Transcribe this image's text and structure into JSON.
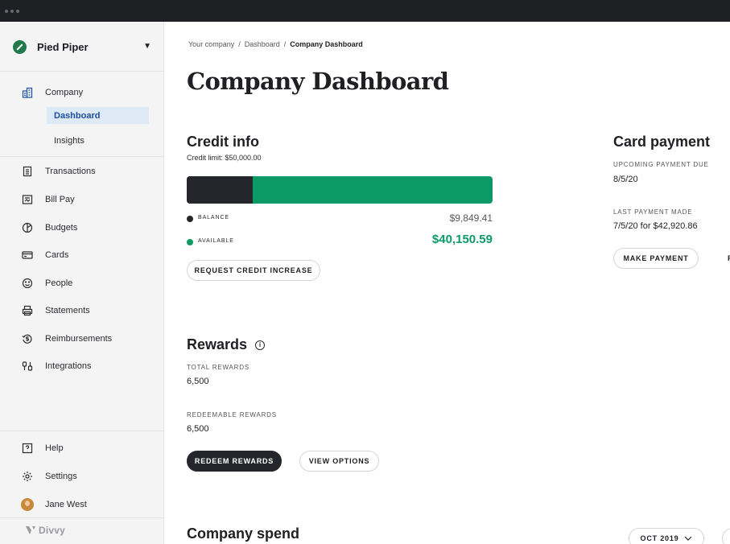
{
  "org": {
    "name": "Pied Piper"
  },
  "sidebar": {
    "company_label": "Company",
    "sub_items": [
      {
        "label": "Dashboard",
        "active": true
      },
      {
        "label": "Insights",
        "active": false
      }
    ],
    "items": [
      {
        "label": "Transactions",
        "icon": "receipt-icon"
      },
      {
        "label": "Bill Pay",
        "icon": "bill-icon"
      },
      {
        "label": "Budgets",
        "icon": "budget-icon"
      },
      {
        "label": "Cards",
        "icon": "card-icon"
      },
      {
        "label": "People",
        "icon": "smile-icon"
      },
      {
        "label": "Statements",
        "icon": "printer-icon"
      },
      {
        "label": "Reimbursements",
        "icon": "refund-icon"
      },
      {
        "label": "Integrations",
        "icon": "plug-icon"
      }
    ],
    "footer": {
      "help": "Help",
      "settings": "Settings",
      "user": "Jane West"
    },
    "brand": "Divvy"
  },
  "breadcrumb": {
    "items": [
      "Your company",
      "Dashboard",
      "Company Dashboard"
    ],
    "separator": "/"
  },
  "page_title": "Company Dashboard",
  "credit_info": {
    "title": "Credit info",
    "limit_text": "Credit limit: $50,000.00",
    "used_fraction": 0.2148,
    "balance_label": "BALANCE",
    "balance_value": "$9,849.41",
    "available_label": "AVAILABLE",
    "available_value": "$40,150.59",
    "request_button": "REQUEST CREDIT INCREASE",
    "colors": {
      "balance": "#25262b",
      "available": "#0b9a66"
    }
  },
  "card_payment": {
    "title": "Card payment",
    "upcoming_label": "UPCOMING PAYMENT DUE",
    "upcoming_value": "8/5/20",
    "last_label": "LAST PAYMENT MADE",
    "last_value": "7/5/20 for $42,920.86",
    "make_payment_button": "MAKE PAYMENT",
    "next_button_partial": "P"
  },
  "rewards": {
    "title": "Rewards",
    "total_label": "TOTAL REWARDS",
    "total_value": "6,500",
    "redeemable_label": "REDEEMABLE REWARDS",
    "redeemable_value": "6,500",
    "redeem_button": "REDEEM REWARDS",
    "view_options_button": "VIEW OPTIONS"
  },
  "company_spend": {
    "title": "Company spend",
    "period": "OCT 2019"
  }
}
